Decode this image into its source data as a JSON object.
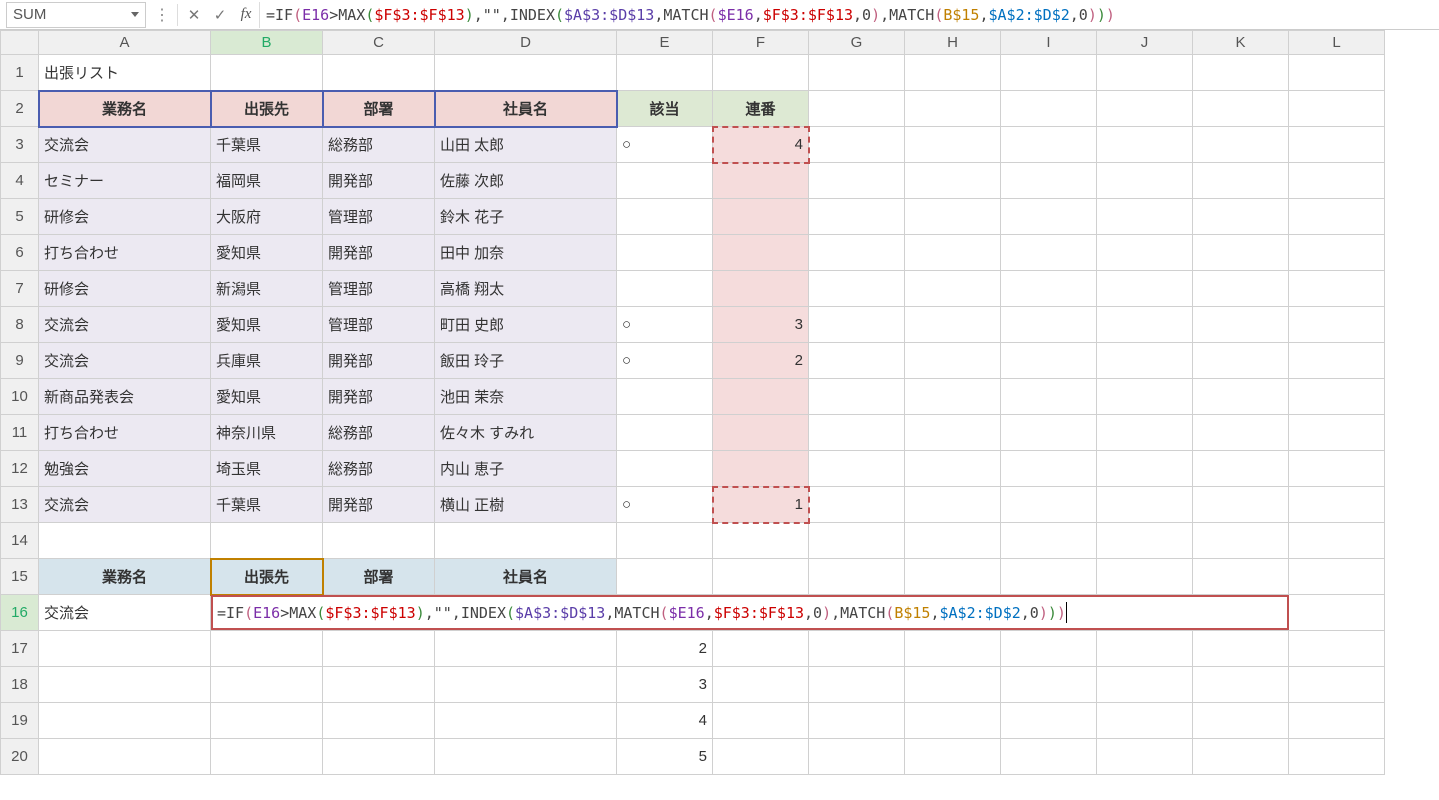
{
  "namebox": "SUM",
  "fx_label": "fx",
  "formula_raw": "=IF(E16>MAX($F$3:$F$13),\"\",INDEX($A$3:$D$13,MATCH($E16,$F$3:$F$13,0),MATCH(B$15,$A$2:$D$2,0)))",
  "tokens": [
    {
      "t": "=",
      "c": "tok-if"
    },
    {
      "t": "IF",
      "c": "tok-if"
    },
    {
      "t": "(",
      "c": "tok-pk"
    },
    {
      "t": "E16",
      "c": "tok-e16"
    },
    {
      "t": ">",
      "c": "tok-if"
    },
    {
      "t": "MAX",
      "c": "tok-fn"
    },
    {
      "t": "(",
      "c": "tok-gr"
    },
    {
      "t": "$F$3:$F$13",
      "c": "tok-f3"
    },
    {
      "t": ")",
      "c": "tok-gr"
    },
    {
      "t": ",\"\",",
      "c": "tok-if"
    },
    {
      "t": "INDEX",
      "c": "tok-fn"
    },
    {
      "t": "(",
      "c": "tok-gr"
    },
    {
      "t": "$A$3:$D$13",
      "c": "tok-a3"
    },
    {
      "t": ",",
      "c": "tok-if"
    },
    {
      "t": "MATCH",
      "c": "tok-fn"
    },
    {
      "t": "(",
      "c": "tok-pk"
    },
    {
      "t": "$E16",
      "c": "tok-e16"
    },
    {
      "t": ",",
      "c": "tok-if"
    },
    {
      "t": "$F$3:$F$13",
      "c": "tok-f3"
    },
    {
      "t": ",0",
      "c": "tok-if"
    },
    {
      "t": ")",
      "c": "tok-pk"
    },
    {
      "t": ",",
      "c": "tok-if"
    },
    {
      "t": "MATCH",
      "c": "tok-fn"
    },
    {
      "t": "(",
      "c": "tok-pk"
    },
    {
      "t": "B$15",
      "c": "tok-b15"
    },
    {
      "t": ",",
      "c": "tok-if"
    },
    {
      "t": "$A$2:$D$2",
      "c": "tok-a2"
    },
    {
      "t": ",0",
      "c": "tok-if"
    },
    {
      "t": ")",
      "c": "tok-pk"
    },
    {
      "t": ")",
      "c": "tok-gr"
    },
    {
      "t": ")",
      "c": "tok-pk"
    }
  ],
  "columns": [
    "A",
    "B",
    "C",
    "D",
    "E",
    "F",
    "G",
    "H",
    "I",
    "J",
    "K",
    "L"
  ],
  "rows": [
    "1",
    "2",
    "3",
    "4",
    "5",
    "6",
    "7",
    "8",
    "9",
    "10",
    "11",
    "12",
    "13",
    "14",
    "15",
    "16",
    "17",
    "18",
    "19",
    "20"
  ],
  "a1": "出張リスト",
  "hdr": {
    "A": "業務名",
    "B": "出張先",
    "C": "部署",
    "D": "社員名",
    "E": "該当",
    "F": "連番"
  },
  "data_rows": [
    {
      "A": "交流会",
      "B": "千葉県",
      "C": "総務部",
      "D": "山田 太郎",
      "E": "○",
      "F": "4"
    },
    {
      "A": "セミナー",
      "B": "福岡県",
      "C": "開発部",
      "D": "佐藤 次郎",
      "E": "",
      "F": ""
    },
    {
      "A": "研修会",
      "B": "大阪府",
      "C": "管理部",
      "D": "鈴木 花子",
      "E": "",
      "F": ""
    },
    {
      "A": "打ち合わせ",
      "B": "愛知県",
      "C": "開発部",
      "D": "田中 加奈",
      "E": "",
      "F": ""
    },
    {
      "A": "研修会",
      "B": "新潟県",
      "C": "管理部",
      "D": "高橋 翔太",
      "E": "",
      "F": ""
    },
    {
      "A": "交流会",
      "B": "愛知県",
      "C": "管理部",
      "D": "町田 史郎",
      "E": "○",
      "F": "3"
    },
    {
      "A": "交流会",
      "B": "兵庫県",
      "C": "開発部",
      "D": "飯田 玲子",
      "E": "○",
      "F": "2"
    },
    {
      "A": "新商品発表会",
      "B": "愛知県",
      "C": "開発部",
      "D": "池田 茉奈",
      "E": "",
      "F": ""
    },
    {
      "A": "打ち合わせ",
      "B": "神奈川県",
      "C": "総務部",
      "D": "佐々木 すみれ",
      "E": "",
      "F": ""
    },
    {
      "A": "勉強会",
      "B": "埼玉県",
      "C": "総務部",
      "D": "内山 恵子",
      "E": "",
      "F": ""
    },
    {
      "A": "交流会",
      "B": "千葉県",
      "C": "開発部",
      "D": "横山 正樹",
      "E": "○",
      "F": "1"
    }
  ],
  "hdr15": {
    "A": "業務名",
    "B": "出張先",
    "C": "部署",
    "D": "社員名"
  },
  "a16": "交流会",
  "e_seq": {
    "17": "2",
    "18": "3",
    "19": "4",
    "20": "5"
  }
}
